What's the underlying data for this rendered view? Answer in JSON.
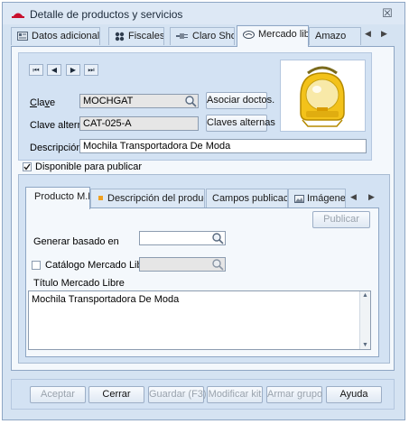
{
  "window": {
    "title": "Detalle de productos y servicios",
    "close_glyph": "☒"
  },
  "tabs": [
    {
      "label": "Datos adicionales",
      "icon": "card-icon"
    },
    {
      "label": "Fiscales",
      "icon": "grid-icon"
    },
    {
      "label": "Claro Shop",
      "icon": "plug-icon"
    },
    {
      "label": "Mercado libre",
      "icon": "handshake-icon"
    },
    {
      "label": "Amazo",
      "icon": ""
    }
  ],
  "nav": {
    "first": "⏮",
    "prev": "◀",
    "next": "▶",
    "last": "⏭"
  },
  "form": {
    "clave_label": "Clave",
    "clave_value": "MOCHGAT",
    "asociar_label": "Asociar doctos.",
    "clave_alterna_label": "Clave alterna",
    "clave_alterna_value": "CAT-025-A",
    "claves_alternas_label": "Claves alternas",
    "descripcion_label": "Descripción",
    "descripcion_value": "Mochila Transportadora De Moda",
    "disponible_label": "Disponible para publicar",
    "disponible_checked": true
  },
  "subtabs": [
    {
      "label": "Producto M.L"
    },
    {
      "label": "Descripción del producto"
    },
    {
      "label": "Campos publicación"
    },
    {
      "label": "Imágenes"
    }
  ],
  "ml": {
    "publicar_label": "Publicar",
    "generar_label": "Generar basado en",
    "generar_value": "",
    "catalogo_label": "Catálogo Mercado Libre",
    "catalogo_value": "",
    "titulo_label": "Título Mercado Libre",
    "titulo_value": "Mochila Transportadora De Moda"
  },
  "footer": {
    "aceptar": "Aceptar",
    "cerrar": "Cerrar",
    "guardar": "Guardar (F3)",
    "modificar": "Modificar kit",
    "armar": "Armar grupo",
    "ayuda": "Ayuda"
  }
}
